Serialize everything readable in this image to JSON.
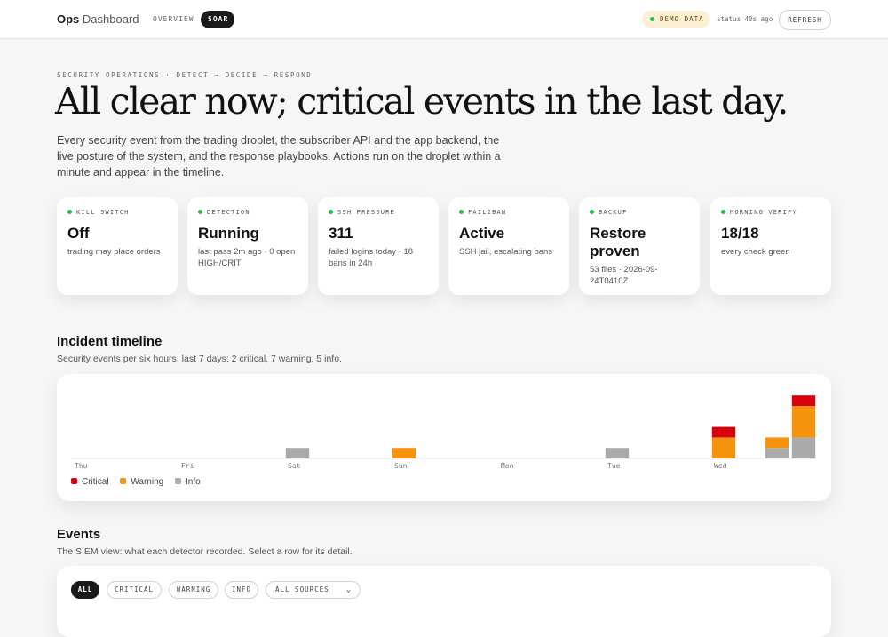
{
  "header": {
    "brand_bold": "Ops",
    "brand_light": "Dashboard",
    "tabs": [
      {
        "label": "OVERVIEW",
        "active": false
      },
      {
        "label": "SOAR",
        "active": true
      }
    ],
    "demo_badge": "DEMO DATA",
    "status": "status 40s ago",
    "refresh_label": "REFRESH"
  },
  "hero": {
    "eyebrow": "SECURITY OPERATIONS · DETECT → DECIDE → RESPOND",
    "title": "All clear now; critical events in the last day.",
    "lede": "Every security event from the trading droplet, the subscriber API and the app backend, the live posture of the system, and the response playbooks. Actions run on the droplet within a minute and appear in the timeline."
  },
  "kpis": [
    {
      "label": "KILL SWITCH",
      "value": "Off",
      "sub": "trading may place orders",
      "status_color": "#2fb84a"
    },
    {
      "label": "DETECTION",
      "value": "Running",
      "sub": "last pass 2m ago · 0 open HIGH/CRIT",
      "status_color": "#2fb84a"
    },
    {
      "label": "SSH PRESSURE",
      "value": "311",
      "sub": "failed logins today · 18 bans in 24h",
      "status_color": "#2fb84a"
    },
    {
      "label": "FAIL2BAN",
      "value": "Active",
      "sub": "SSH jail, escalating bans",
      "status_color": "#2fb84a"
    },
    {
      "label": "BACKUP",
      "value": "Restore proven",
      "sub": "53 files · 2026-09-24T0410Z",
      "status_color": "#2fb84a"
    },
    {
      "label": "MORNING VERIFY",
      "value": "18/18",
      "sub": "every check green",
      "status_color": "#2fb84a"
    }
  ],
  "timeline": {
    "title": "Incident timeline",
    "subtitle": "Security events per six hours, last 7 days: 2 critical, 7 warning, 5 info."
  },
  "chart_data": {
    "type": "bar",
    "stacked": true,
    "x_labels": [
      "Thu",
      "Fri",
      "Sat",
      "Sun",
      "Mon",
      "Tue",
      "Wed"
    ],
    "buckets_per_day": 4,
    "series": [
      {
        "name": "Info",
        "color": "#aaaaaa",
        "values": [
          0,
          0,
          0,
          0,
          0,
          0,
          0,
          0,
          1,
          0,
          0,
          0,
          0,
          0,
          0,
          0,
          0,
          0,
          0,
          0,
          1,
          0,
          0,
          0,
          0,
          0,
          1,
          2
        ]
      },
      {
        "name": "Warning",
        "color": "#f5930d",
        "values": [
          0,
          0,
          0,
          0,
          0,
          0,
          0,
          0,
          0,
          0,
          0,
          0,
          1,
          0,
          0,
          0,
          0,
          0,
          0,
          0,
          0,
          0,
          0,
          0,
          2,
          0,
          1,
          3
        ]
      },
      {
        "name": "Critical",
        "color": "#d9000d",
        "values": [
          0,
          0,
          0,
          0,
          0,
          0,
          0,
          0,
          0,
          0,
          0,
          0,
          0,
          0,
          0,
          0,
          0,
          0,
          0,
          0,
          0,
          0,
          0,
          0,
          1,
          0,
          0,
          1
        ]
      }
    ],
    "legend": [
      "Critical",
      "Warning",
      "Info"
    ],
    "legend_position": "bottom-left",
    "grid": false
  },
  "events": {
    "title": "Events",
    "subtitle": "The SIEM view: what each detector recorded. Select a row for its detail.",
    "filters": [
      {
        "label": "ALL",
        "active": true
      },
      {
        "label": "CRITICAL",
        "active": false
      },
      {
        "label": "WARNING",
        "active": false
      },
      {
        "label": "INFO",
        "active": false
      }
    ],
    "source_select": "ALL SOURCES"
  }
}
